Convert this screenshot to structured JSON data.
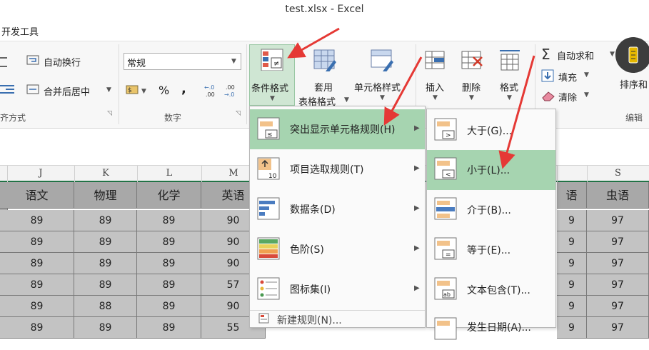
{
  "window": {
    "title": "test.xlsx - Excel"
  },
  "menubar": {
    "tab": "开发工具"
  },
  "ribbon": {
    "wrap_text": "自动换行",
    "merge_center": "合并后居中",
    "number_format": "常规",
    "percent": "%",
    "comma": ",",
    "alignment_group": "齐方式",
    "number_group": "数字",
    "conditional_format": "条件格式",
    "table_format_1": "套用",
    "table_format_2": "表格格式",
    "cell_styles": "单元格样式",
    "insert": "插入",
    "delete": "删除",
    "format": "格式",
    "autosum": "自动求和",
    "fill": "填充",
    "clear": "清除",
    "sort": "排序和",
    "edit_group": "编辑"
  },
  "columns": [
    "J",
    "K",
    "L",
    "M",
    "S"
  ],
  "table": {
    "headers": [
      "语文",
      "物理",
      "化学",
      "英语",
      "语",
      "虫语"
    ],
    "rows": [
      [
        "89",
        "89",
        "89",
        "90",
        "9",
        "97"
      ],
      [
        "89",
        "89",
        "89",
        "90",
        "9",
        "97"
      ],
      [
        "89",
        "89",
        "89",
        "90",
        "9",
        "97"
      ],
      [
        "89",
        "89",
        "89",
        "57",
        "9",
        "97"
      ],
      [
        "89",
        "88",
        "89",
        "90",
        "9",
        "97"
      ],
      [
        "89",
        "89",
        "89",
        "55",
        "9",
        "97"
      ]
    ]
  },
  "menu_main": {
    "items": [
      {
        "label": "突出显示单元格规则(H)",
        "icon": "highlight-rules-icon",
        "highlighted": true
      },
      {
        "label": "项目选取规则(T)",
        "icon": "top-bottom-rules-icon"
      },
      {
        "label": "数据条(D)",
        "icon": "data-bars-icon"
      },
      {
        "label": "色阶(S)",
        "icon": "color-scales-icon"
      },
      {
        "label": "图标集(I)",
        "icon": "icon-sets-icon"
      },
      {
        "label": "新建规则(N)...",
        "icon": "new-rule-icon"
      }
    ]
  },
  "menu_sub": {
    "items": [
      {
        "label": "大于(G)...",
        "icon": "greater-than-icon"
      },
      {
        "label": "小于(L)...",
        "icon": "less-than-icon",
        "highlighted": true
      },
      {
        "label": "介于(B)...",
        "icon": "between-icon"
      },
      {
        "label": "等于(E)...",
        "icon": "equal-to-icon"
      },
      {
        "label": "文本包含(T)...",
        "icon": "text-contains-icon"
      },
      {
        "label": "发生日期(A)...",
        "icon": "date-occurring-icon"
      }
    ]
  },
  "colors": {
    "highlight": "#a6d4b0",
    "arrow": "#e53935",
    "header_fill": "#a8a8a8",
    "cell_fill": "#c3c3c3"
  }
}
